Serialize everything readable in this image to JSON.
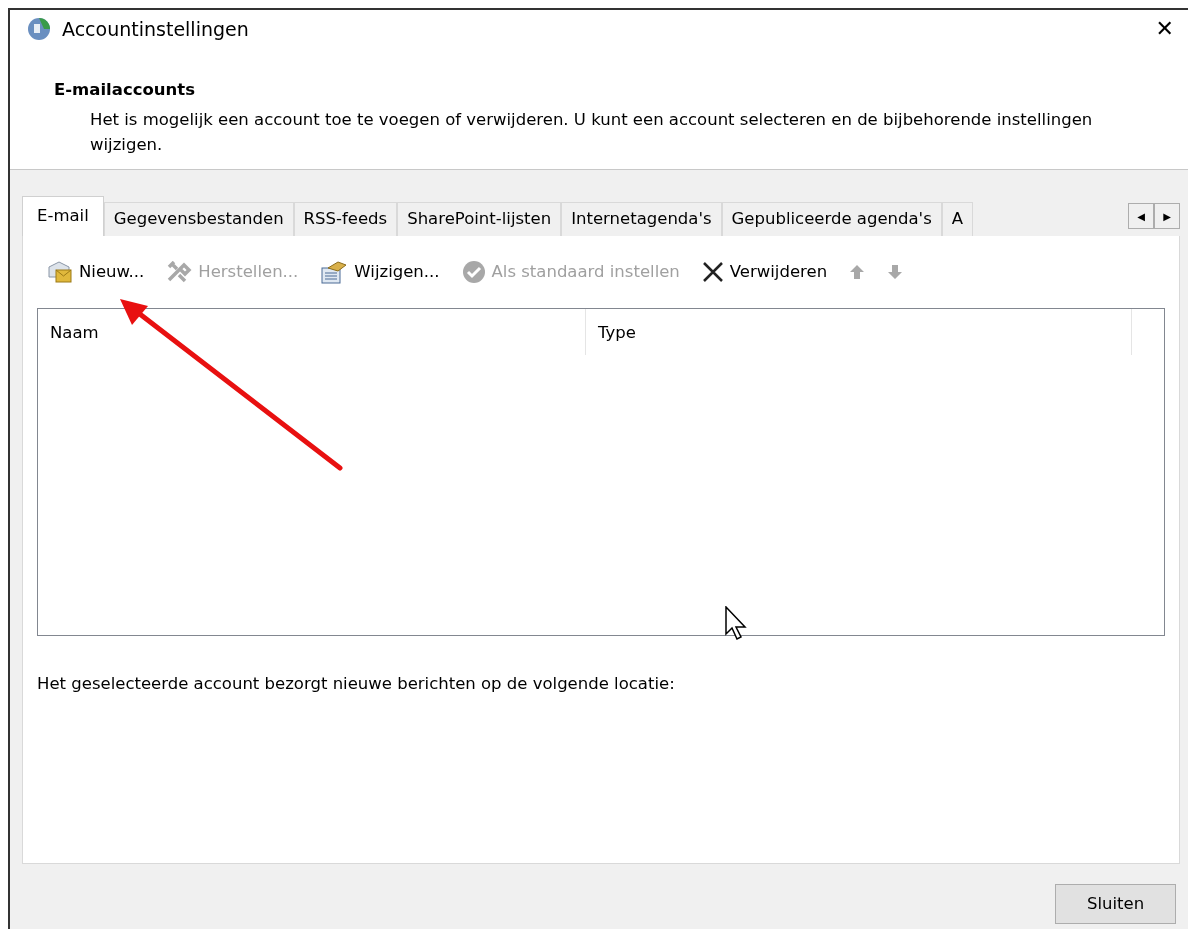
{
  "window": {
    "title": "Accountinstellingen",
    "close": "✕"
  },
  "header": {
    "heading": "E-mailaccounts",
    "description": "Het is mogelijk een account toe te voegen of verwijderen. U kunt een account selecteren en de bijbehorende instellingen wijzigen."
  },
  "tabs": [
    {
      "label": "E-mail",
      "selected": true
    },
    {
      "label": "Gegevensbestanden",
      "selected": false
    },
    {
      "label": "RSS-feeds",
      "selected": false
    },
    {
      "label": "SharePoint-lijsten",
      "selected": false
    },
    {
      "label": "Internetagenda's",
      "selected": false
    },
    {
      "label": "Gepubliceerde agenda's",
      "selected": false
    },
    {
      "label": "A",
      "selected": false
    }
  ],
  "tab_scroll": {
    "left": "◀",
    "right": "▶"
  },
  "toolbar": [
    {
      "kind": "new",
      "label": "Nieuw...",
      "disabled": false
    },
    {
      "kind": "repair",
      "label": "Herstellen...",
      "disabled": true
    },
    {
      "kind": "change",
      "label": "Wijzigen...",
      "disabled": false
    },
    {
      "kind": "default",
      "label": "Als standaard instellen",
      "disabled": true
    },
    {
      "kind": "remove",
      "label": "Verwijderen",
      "disabled": false
    },
    {
      "kind": "up",
      "disabled": true
    },
    {
      "kind": "down",
      "disabled": true
    }
  ],
  "table": {
    "columns": [
      "Naam",
      "Type"
    ]
  },
  "location_text": "Het geselecteerde account bezorgt nieuwe berichten op de volgende locatie:",
  "buttons": [
    {
      "label": "Sluiten"
    }
  ]
}
